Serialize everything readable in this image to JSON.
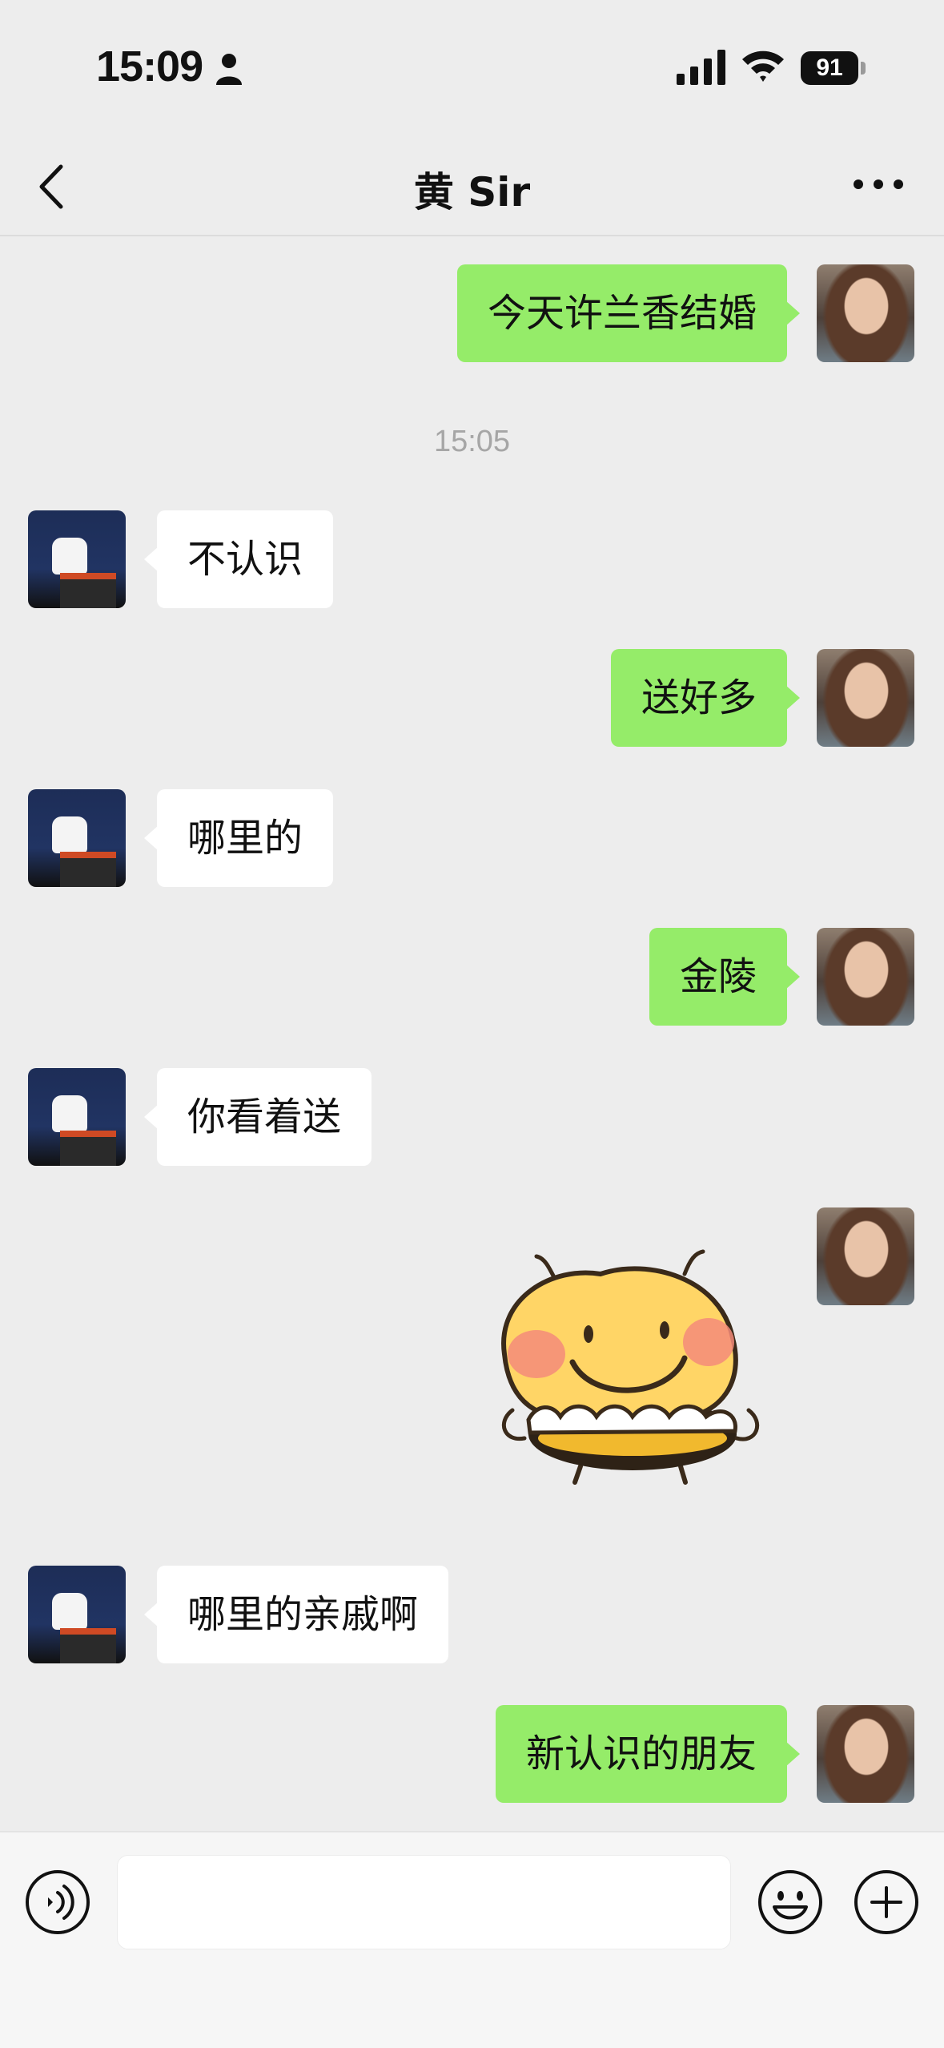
{
  "status_bar": {
    "time": "15:09",
    "battery": "91"
  },
  "header": {
    "title": "黄  Sir"
  },
  "chat": {
    "timestamp": "15:05",
    "messages": [
      {
        "from": "me",
        "text": "今天许兰香结婚"
      },
      {
        "from": "other",
        "text": "不认识"
      },
      {
        "from": "me",
        "text": "送好多"
      },
      {
        "from": "other",
        "text": "哪里的"
      },
      {
        "from": "me",
        "text": "金陵"
      },
      {
        "from": "other",
        "text": "你看着送"
      },
      {
        "from": "me",
        "sticker": "smiling-bee-sticker"
      },
      {
        "from": "other",
        "text": "哪里的亲戚啊"
      },
      {
        "from": "me",
        "text": "新认识的朋友"
      }
    ]
  },
  "icons": {
    "back": "back-chevron-icon",
    "more": "more-dots-icon",
    "voice": "voice-icon",
    "emoji": "emoji-icon",
    "plus": "plus-icon"
  },
  "colors": {
    "outgoing_bubble": "#95ec69",
    "incoming_bubble": "#ffffff",
    "background": "#ededed"
  }
}
